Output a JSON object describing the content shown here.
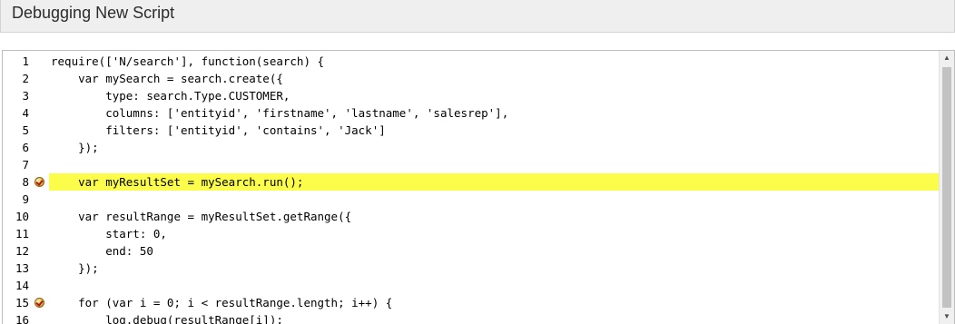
{
  "header": {
    "title": "Debugging New Script"
  },
  "editor": {
    "lines": [
      {
        "num": "1",
        "code": "require(['N/search'], function(search) {",
        "breakpoint": false,
        "highlight": false
      },
      {
        "num": "2",
        "code": "    var mySearch = search.create({",
        "breakpoint": false,
        "highlight": false
      },
      {
        "num": "3",
        "code": "        type: search.Type.CUSTOMER,",
        "breakpoint": false,
        "highlight": false
      },
      {
        "num": "4",
        "code": "        columns: ['entityid', 'firstname', 'lastname', 'salesrep'],",
        "breakpoint": false,
        "highlight": false
      },
      {
        "num": "5",
        "code": "        filters: ['entityid', 'contains', 'Jack']",
        "breakpoint": false,
        "highlight": false
      },
      {
        "num": "6",
        "code": "    });",
        "breakpoint": false,
        "highlight": false
      },
      {
        "num": "7",
        "code": "",
        "breakpoint": false,
        "highlight": false
      },
      {
        "num": "8",
        "code": "    var myResultSet = mySearch.run();",
        "breakpoint": true,
        "highlight": true
      },
      {
        "num": "9",
        "code": "",
        "breakpoint": false,
        "highlight": false
      },
      {
        "num": "10",
        "code": "    var resultRange = myResultSet.getRange({",
        "breakpoint": false,
        "highlight": false
      },
      {
        "num": "11",
        "code": "        start: 0,",
        "breakpoint": false,
        "highlight": false
      },
      {
        "num": "12",
        "code": "        end: 50",
        "breakpoint": false,
        "highlight": false
      },
      {
        "num": "13",
        "code": "    });",
        "breakpoint": false,
        "highlight": false
      },
      {
        "num": "14",
        "code": "",
        "breakpoint": false,
        "highlight": false
      },
      {
        "num": "15",
        "code": "    for (var i = 0; i < resultRange.length; i++) {",
        "breakpoint": true,
        "highlight": false
      },
      {
        "num": "16",
        "code": "        log.debug(resultRange[i]);",
        "breakpoint": false,
        "highlight": false
      }
    ]
  },
  "scrollbar": {
    "up_icon": "scroll-up-arrow-icon",
    "down_icon": "scroll-down-arrow-icon"
  },
  "colors": {
    "highlight": "#fcfc4a",
    "title_bar_bg": "#efefef",
    "scroll_thumb": "#c2c2c2"
  }
}
